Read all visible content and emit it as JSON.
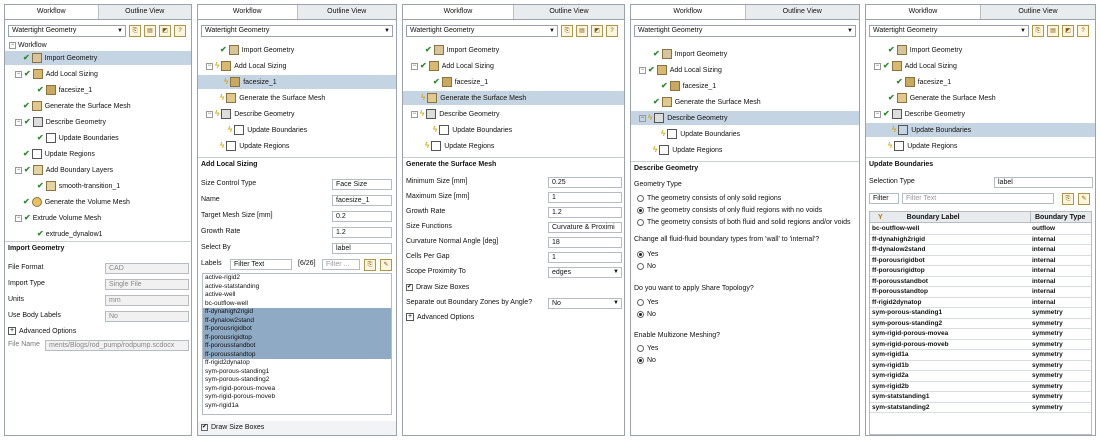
{
  "tabs": {
    "workflow": "Workflow",
    "outline": "Outline View"
  },
  "workflow_type": "Watertight Geometry",
  "tree": {
    "root": "Workflow",
    "import_geometry": "Import Geometry",
    "add_local_sizing": "Add Local Sizing",
    "facesize": "facesize_1",
    "generate_surface_mesh": "Generate the Surface Mesh",
    "describe_geometry": "Describe Geometry",
    "update_boundaries": "Update Boundaries",
    "update_regions": "Update Regions",
    "add_boundary_layers": "Add Boundary Layers",
    "smooth_transition": "smooth-transition_1",
    "generate_volume_mesh": "Generate the Volume Mesh",
    "extrude_volume_mesh": "Extrude Volume Mesh",
    "extrude_dynalow": "extrude_dynalow1"
  },
  "panel1": {
    "title": "Import Geometry",
    "rows": [
      {
        "label": "File Format",
        "value": "CAD"
      },
      {
        "label": "Import Type",
        "value": "Single File"
      },
      {
        "label": "Units",
        "value": "mm"
      },
      {
        "label": "Use Body Labels",
        "value": "No"
      }
    ],
    "advanced": "Advanced Options",
    "file_name_label": "File Name",
    "file_name_value": "ments/Blogs/rod_pump/rodpump.scdocx"
  },
  "panel2": {
    "title": "Add Local Sizing",
    "rows": [
      {
        "label": "Size Control Type",
        "value": "Face Size"
      },
      {
        "label": "Name",
        "value": "facesize_1"
      },
      {
        "label": "Target Mesh Size [mm]",
        "value": "0.2"
      },
      {
        "label": "Growth Rate",
        "value": "1.2"
      },
      {
        "label": "Select By",
        "value": "label"
      }
    ],
    "labels_label": "Labels",
    "filter_text": "Filter Text",
    "count": "[6/26]",
    "filter_placeholder": "Filter ...",
    "list": [
      "active-rigid2",
      "active-statstanding",
      "active-well",
      "bc-outflow-well",
      "ff-dynahigh2rigid",
      "ff-dynalow2stand",
      "ff-porousrigidbot",
      "ff-porousrigidtop",
      "ff-porousstandbot",
      "ff-porousstandtop",
      "ff-rigid2dynatop",
      "sym-porous-standing1",
      "sym-porous-standing2",
      "sym-rigid-porous-movea",
      "sym-rigid-porous-moveb",
      "sym-rigid1a"
    ],
    "draw_size_boxes": "Draw Size Boxes"
  },
  "panel3": {
    "title": "Generate the Surface Mesh",
    "rows": [
      {
        "label": "Minimum Size [mm]",
        "value": "0.25"
      },
      {
        "label": "Maximum Size [mm]",
        "value": "1"
      },
      {
        "label": "Growth Rate",
        "value": "1.2"
      },
      {
        "label": "Size Functions",
        "value": "Curvature & Proximi"
      },
      {
        "label": "Curvature Normal Angle [deg]",
        "value": "18"
      },
      {
        "label": "Cells Per Gap",
        "value": "1"
      },
      {
        "label": "Scope Proximity To",
        "value": "edges"
      }
    ],
    "draw_size_boxes": "Draw Size Boxes",
    "separate_label": "Separate out Boundary Zones by Angle?",
    "separate_value": "No",
    "advanced": "Advanced Options"
  },
  "panel4": {
    "title": "Describe Geometry",
    "geometry_type_label": "Geometry Type",
    "geometry_options": [
      "The geometry consists of only solid regions",
      "The geometry consists of only fluid regions with no voids",
      "The geometry consists of both fluid and solid regions and/or voids"
    ],
    "q_change": "Change all fluid-fluid boundary types from 'wall' to 'internal'?",
    "q_share": "Do you want to apply Share Topology?",
    "q_multizone": "Enable Multizone Meshing?",
    "yes": "Yes",
    "no": "No"
  },
  "panel5": {
    "title": "Update Boundaries",
    "selection_type_label": "Selection Type",
    "selection_type_value": "label",
    "filter_btn": "Filter",
    "filter_placeholder": "Filter Text",
    "col_label": "Boundary Label",
    "col_type": "Boundary Type",
    "rows": [
      {
        "label": "bc-outflow-well",
        "type": "outflow"
      },
      {
        "label": "ff-dynahigh2rigid",
        "type": "internal"
      },
      {
        "label": "ff-dynalow2stand",
        "type": "internal"
      },
      {
        "label": "ff-porousrigidbot",
        "type": "internal"
      },
      {
        "label": "ff-porousrigidtop",
        "type": "internal"
      },
      {
        "label": "ff-porousstandbot",
        "type": "internal"
      },
      {
        "label": "ff-porousstandtop",
        "type": "internal"
      },
      {
        "label": "ff-rigid2dynatop",
        "type": "internal"
      },
      {
        "label": "sym-porous-standing1",
        "type": "symmetry"
      },
      {
        "label": "sym-porous-standing2",
        "type": "symmetry"
      },
      {
        "label": "sym-rigid-porous-movea",
        "type": "symmetry"
      },
      {
        "label": "sym-rigid-porous-moveb",
        "type": "symmetry"
      },
      {
        "label": "sym-rigid1a",
        "type": "symmetry"
      },
      {
        "label": "sym-rigid1b",
        "type": "symmetry"
      },
      {
        "label": "sym-rigid2a",
        "type": "symmetry"
      },
      {
        "label": "sym-rigid2b",
        "type": "symmetry"
      },
      {
        "label": "sym-statstanding1",
        "type": "symmetry"
      },
      {
        "label": "sym-statstanding2",
        "type": "symmetry"
      }
    ]
  }
}
